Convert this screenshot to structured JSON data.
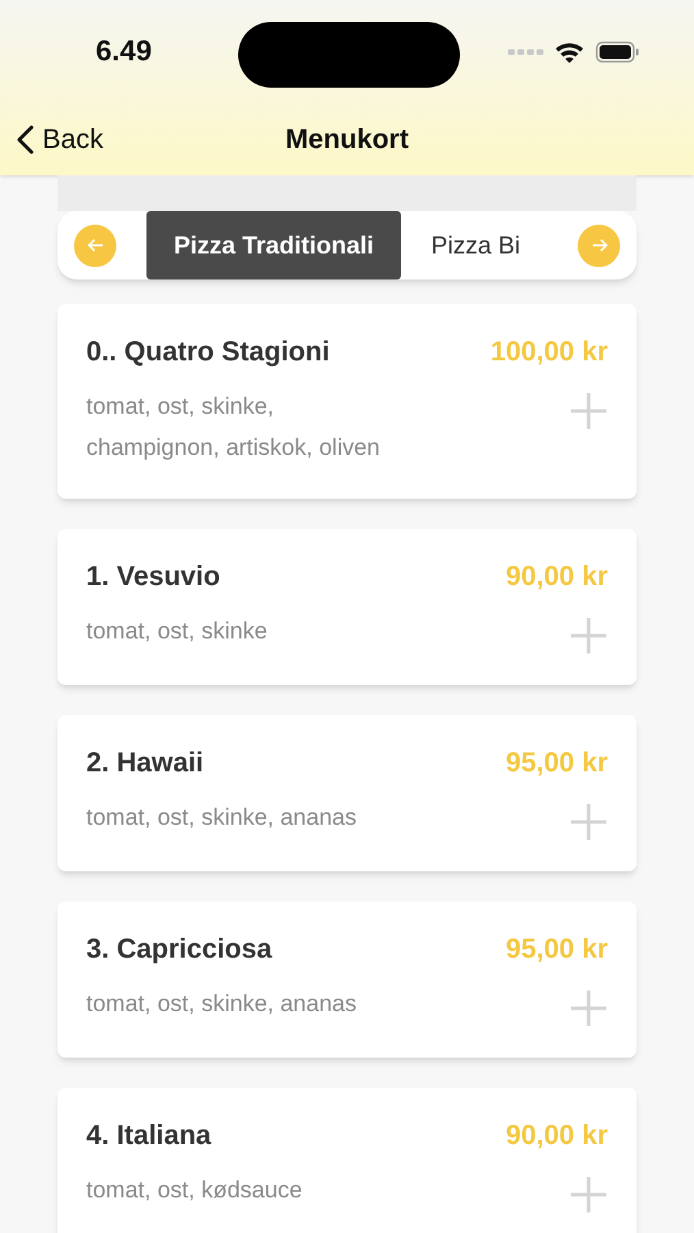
{
  "status_bar": {
    "time": "6.49"
  },
  "nav": {
    "back": "Back",
    "title": "Menukort"
  },
  "categories": [
    {
      "label": "Pizza Traditionali",
      "selected": true
    },
    {
      "label": "Pizza Bi",
      "selected": false
    }
  ],
  "items": [
    {
      "name": "0.. Quatro Stagioni",
      "price": "100,00 kr",
      "description": "tomat, ost, skinke, champignon, artiskok, oliven"
    },
    {
      "name": "1. Vesuvio",
      "price": "90,00 kr",
      "description": "tomat, ost, skinke"
    },
    {
      "name": "2. Hawaii",
      "price": "95,00 kr",
      "description": "tomat, ost, skinke, ananas"
    },
    {
      "name": "3. Capricciosa",
      "price": "95,00 kr",
      "description": "tomat, ost, skinke, ananas"
    },
    {
      "name": "4. Italiana",
      "price": "90,00 kr",
      "description": "tomat, ost, kødsauce"
    }
  ]
}
